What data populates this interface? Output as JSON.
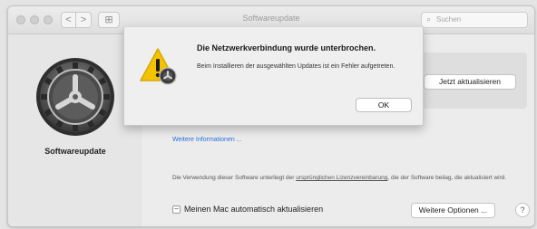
{
  "window": {
    "title": "Softwareupdate",
    "nav_back": "<",
    "nav_forward": ">",
    "grid_glyph": "⊞"
  },
  "search": {
    "placeholder": "Suchen",
    "icon": "magnifying-glass-icon"
  },
  "sidebar": {
    "pane_name": "Softwareupdate",
    "icon": "gear-icon"
  },
  "content": {
    "update_button": "Jetzt aktualisieren",
    "more_info_link": "Weitere Informationen ...",
    "legal_text_before": "Die Verwendung dieser Software unterliegt der ",
    "legal_link": "ursprünglichen Lizenzvereinbarung",
    "legal_text_after": ", die der Software beilag, die aktualisiert wird.",
    "auto_update_label": "Meinen Mac automatisch aktualisieren",
    "auto_update_state": "mixed",
    "auto_update_glyph": "–",
    "options_button": "Weitere Optionen ...",
    "help_button": "?"
  },
  "alert": {
    "title": "Die Netzwerkverbindung wurde unterbrochen.",
    "message": "Beim Installieren der ausgewählten Updates ist ein Fehler aufgetreten.",
    "ok_button": "OK",
    "icon": "caution-icon"
  },
  "colors": {
    "accent_link": "#2a6fdb",
    "caution_yellow": "#f3c200"
  }
}
